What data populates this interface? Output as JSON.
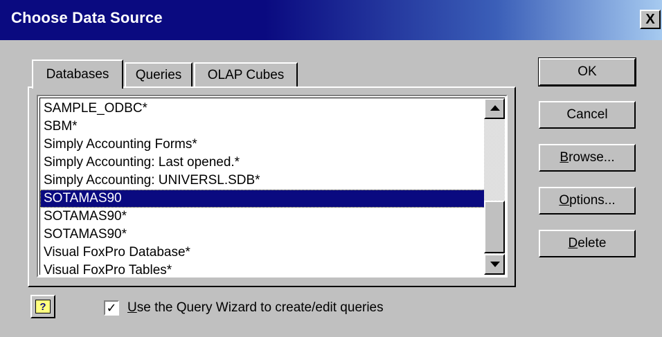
{
  "window": {
    "title": "Choose Data Source",
    "close_label": "X"
  },
  "tabs": [
    {
      "label": "Databases",
      "active": true
    },
    {
      "label": "Queries",
      "active": false
    },
    {
      "label": "OLAP Cubes",
      "active": false
    }
  ],
  "list": {
    "items": [
      "SAMPLE_ODBC*",
      "SBM*",
      "Simply Accounting Forms*",
      "Simply Accounting: Last opened.*",
      "Simply Accounting: UNIVERSL.SDB*",
      "SOTAMAS90",
      "SOTAMAS90*",
      "SOTAMAS90*",
      "Visual FoxPro Database*",
      "Visual FoxPro Tables*"
    ],
    "selected": "SOTAMAS90",
    "selected_index": 5
  },
  "buttons": {
    "ok": "OK",
    "cancel": "Cancel",
    "browse_mn": "B",
    "browse_rest": "rowse...",
    "options_mn": "O",
    "options_rest": "ptions...",
    "delete_mn": "D",
    "delete_rest": "elete"
  },
  "help_button": {
    "glyph": "?"
  },
  "checkbox": {
    "checked": true,
    "check_glyph": "✓",
    "label_mn": "U",
    "label_rest": "se the Query Wizard to create/edit queries"
  }
}
